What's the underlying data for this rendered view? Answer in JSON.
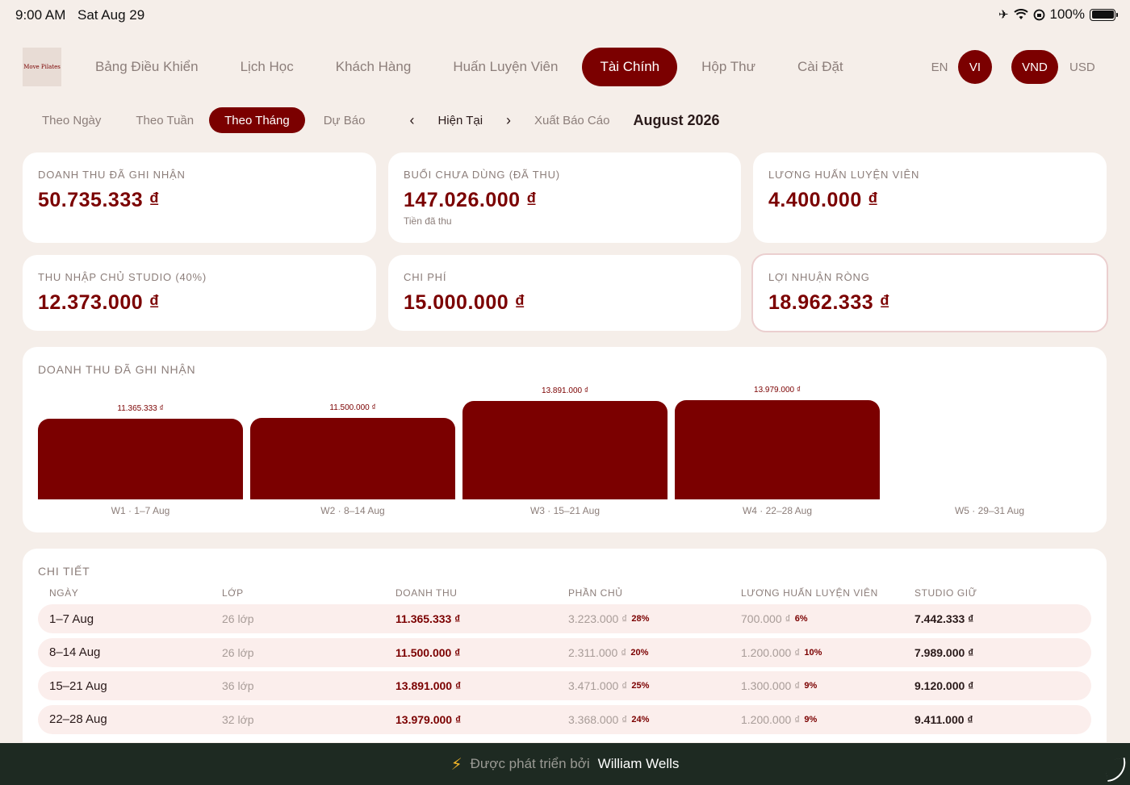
{
  "status": {
    "time": "9:00 AM",
    "date": "Sat Aug 29",
    "battery": "100%"
  },
  "logo": {
    "text": "Move Pilates"
  },
  "nav": [
    {
      "label": "Bảng Điều Khiển",
      "active": false
    },
    {
      "label": "Lịch Học",
      "active": false
    },
    {
      "label": "Khách Hàng",
      "active": false
    },
    {
      "label": "Huấn Luyện Viên",
      "active": false
    },
    {
      "label": "Tài Chính",
      "active": true
    },
    {
      "label": "Hộp Thư",
      "active": false
    },
    {
      "label": "Cài Đặt",
      "active": false
    }
  ],
  "language": {
    "en": "EN",
    "vi": "VI",
    "selected": "VI"
  },
  "currency": {
    "vnd": "VND",
    "usd": "USD",
    "selected": "VND"
  },
  "subnav": {
    "by_day": "Theo Ngày",
    "by_week": "Theo Tuần",
    "by_month": "Theo Tháng",
    "forecast": "Dự Báo",
    "prev": "‹",
    "current": "Hiện Tại",
    "next": "›",
    "export": "Xuất Báo Cáo",
    "month": "August 2026"
  },
  "stats": {
    "revenue": {
      "label": "DOANH THU ĐÃ GHI NHẬN",
      "value": "50.735.333 ₫"
    },
    "unused": {
      "label": "BUỔI CHƯA DÙNG (ĐÃ THU)",
      "value": "147.026.000 ₫",
      "sub": "Tiền đã thu"
    },
    "trainer_salary": {
      "label": "LƯƠNG HUẤN LUYỆN VIÊN",
      "value": "4.400.000 ₫"
    },
    "owner_income": {
      "label": "THU NHẬP CHỦ STUDIO (40%)",
      "value": "12.373.000 ₫"
    },
    "expenses": {
      "label": "CHI PHÍ",
      "value": "15.000.000 ₫"
    },
    "net_profit": {
      "label": "LỢI NHUẬN RÒNG",
      "value": "18.962.333 ₫"
    }
  },
  "chart_section": {
    "title": "DOANH THU ĐÃ GHI NHẬN"
  },
  "chart_data": {
    "type": "bar",
    "categories": [
      "W1 · 1–7 Aug",
      "W2 · 8–14 Aug",
      "W3 · 15–21 Aug",
      "W4 · 22–28 Aug",
      "W5 · 29–31 Aug"
    ],
    "values": [
      11365333,
      11500000,
      13891000,
      13979000,
      0
    ],
    "value_labels": [
      "11.365.333 ₫",
      "11.500.000 ₫",
      "13.891.000 ₫",
      "13.979.000 ₫",
      ""
    ],
    "color": "#7b0000",
    "grid": false
  },
  "table": {
    "title": "CHI TIẾT",
    "headers": [
      "NGÀY",
      "LỚP",
      "DOANH THU",
      "PHẦN CHỦ",
      "LƯƠNG HUẤN LUYỆN VIÊN",
      "STUDIO GIỮ"
    ],
    "rows": [
      {
        "date": "1–7 Aug",
        "classes": "26 lớp",
        "revenue": "11.365.333 ₫",
        "owner": "3.223.000 ₫",
        "owner_pct": "28%",
        "salary": "700.000 ₫",
        "salary_pct": "6%",
        "keep": "7.442.333 ₫"
      },
      {
        "date": "8–14 Aug",
        "classes": "26 lớp",
        "revenue": "11.500.000 ₫",
        "owner": "2.311.000 ₫",
        "owner_pct": "20%",
        "salary": "1.200.000 ₫",
        "salary_pct": "10%",
        "keep": "7.989.000 ₫"
      },
      {
        "date": "15–21 Aug",
        "classes": "36 lớp",
        "revenue": "13.891.000 ₫",
        "owner": "3.471.000 ₫",
        "owner_pct": "25%",
        "salary": "1.300.000 ₫",
        "salary_pct": "9%",
        "keep": "9.120.000 ₫"
      },
      {
        "date": "22–28 Aug",
        "classes": "32 lớp",
        "revenue": "13.979.000 ₫",
        "owner": "3.368.000 ₫",
        "owner_pct": "24%",
        "salary": "1.200.000 ₫",
        "salary_pct": "9%",
        "keep": "9.411.000 ₫"
      }
    ]
  },
  "footer": {
    "prefix": "Được phát triển bởi",
    "name": "William Wells"
  },
  "colors": {
    "accent": "#7b0000",
    "background": "#f5eee9",
    "footer": "#1e2a22"
  }
}
